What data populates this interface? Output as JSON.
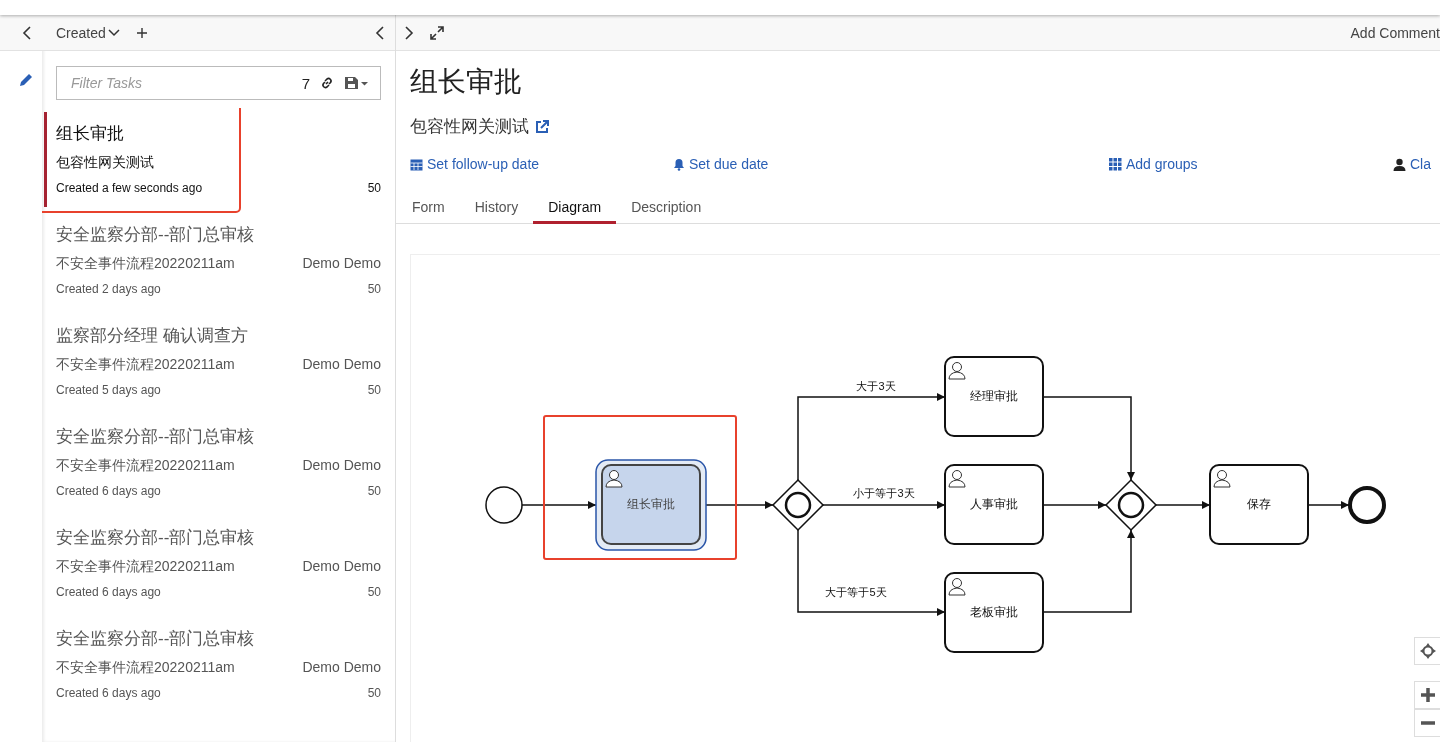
{
  "toolbar": {
    "sort_label": "Created",
    "add_comment": "Add Comment"
  },
  "filter": {
    "placeholder": "Filter Tasks",
    "count": "7"
  },
  "tasks": [
    {
      "title": "组长审批",
      "process": "包容性网关测试",
      "created": "Created a few seconds ago",
      "priority": "50",
      "selected": true,
      "highlighted": true
    },
    {
      "title": "安全监察分部--部门总审核",
      "process": "不安全事件流程20220211am",
      "assignee": "Demo Demo",
      "created": "Created 2 days ago",
      "priority": "50",
      "selected": false,
      "highlighted": false
    },
    {
      "title": "监察部分经理 确认调查方",
      "process": "不安全事件流程20220211am",
      "assignee": "Demo Demo",
      "created": "Created 5 days ago",
      "priority": "50",
      "selected": false,
      "highlighted": false
    },
    {
      "title": "安全监察分部--部门总审核",
      "process": "不安全事件流程20220211am",
      "assignee": "Demo Demo",
      "created": "Created 6 days ago",
      "priority": "50",
      "selected": false,
      "highlighted": false
    },
    {
      "title": "安全监察分部--部门总审核",
      "process": "不安全事件流程20220211am",
      "assignee": "Demo Demo",
      "created": "Created 6 days ago",
      "priority": "50",
      "selected": false,
      "highlighted": false
    },
    {
      "title": "安全监察分部--部门总审核",
      "process": "不安全事件流程20220211am",
      "assignee": "Demo Demo",
      "created": "Created 6 days ago",
      "priority": "50",
      "selected": false,
      "highlighted": false
    }
  ],
  "detail": {
    "title": "组长审批",
    "process": "包容性网关测试",
    "actions": [
      {
        "kind": "calendar",
        "label": "Set follow-up date"
      },
      {
        "kind": "bell",
        "label": "Set due date"
      },
      {
        "kind": "grid",
        "label": "Add groups"
      },
      {
        "kind": "user",
        "label": "Cla"
      }
    ],
    "tabs": [
      {
        "label": "Form",
        "selected": false
      },
      {
        "label": "History",
        "selected": false
      },
      {
        "label": "Diagram",
        "selected": true
      },
      {
        "label": "Description",
        "selected": false
      }
    ]
  },
  "diagram": {
    "nodes": [
      {
        "kind": "start"
      },
      {
        "kind": "task",
        "label": "组长审批",
        "selected": true,
        "highlighted": true
      },
      {
        "kind": "gateway"
      },
      {
        "kind": "task",
        "label": "经理审批",
        "selected": false,
        "highlighted": false
      },
      {
        "kind": "task",
        "label": "人事审批",
        "selected": false,
        "highlighted": false
      },
      {
        "kind": "task",
        "label": "老板审批",
        "selected": false,
        "highlighted": false
      },
      {
        "kind": "gateway"
      },
      {
        "kind": "task",
        "label": "保存",
        "selected": false,
        "highlighted": false
      },
      {
        "kind": "end"
      }
    ],
    "flow_labels": [
      "大于3天",
      "小于等于3天",
      "大于等于5天"
    ]
  }
}
